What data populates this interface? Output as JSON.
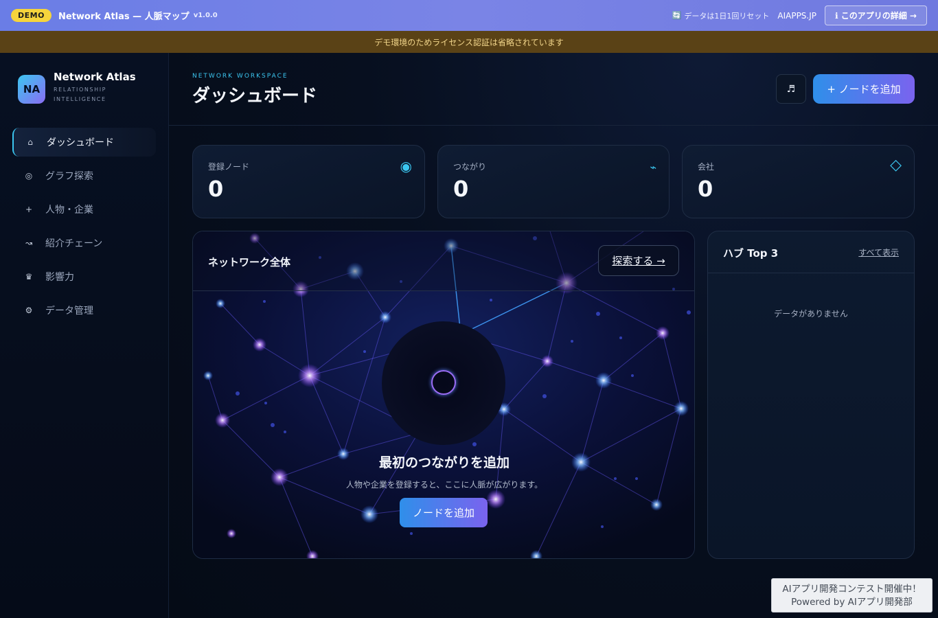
{
  "topbar": {
    "badge": "DEMO",
    "title": "Network Atlas — 人脈マップ",
    "version": "v1.0.0",
    "reset_icon": "🔄",
    "reset_note": "データは1日1回リセット",
    "site": "AIAPPS.JP",
    "detail_button": "ℹ このアプリの詳細 →"
  },
  "license_notice": "デモ環境のためライセンス認証は省略されています",
  "sidebar": {
    "logo": "NA",
    "brand_name": "Network Atlas",
    "brand_sub": "RELATIONSHIP INTELLIGENCE",
    "items": [
      {
        "icon": "⌂",
        "label": "ダッシュボード"
      },
      {
        "icon": "◎",
        "label": "グラフ探索"
      },
      {
        "icon": "+",
        "label": "人物・企業"
      },
      {
        "icon": "↝",
        "label": "紹介チェーン"
      },
      {
        "icon": "♛",
        "label": "影響力"
      },
      {
        "icon": "⚙",
        "label": "データ管理"
      }
    ]
  },
  "header": {
    "eyebrow": "NETWORK WORKSPACE",
    "title": "ダッシュボード",
    "music_icon": "♬",
    "add_button": "+ ノードを追加"
  },
  "stats": [
    {
      "label": "登録ノード",
      "value": "0",
      "icon": "◉"
    },
    {
      "label": "つながり",
      "value": "0",
      "icon": "⌁"
    },
    {
      "label": "会社",
      "value": "0",
      "icon": "◇"
    }
  ],
  "network": {
    "title": "ネットワーク全体",
    "explore_button": "探索する →",
    "empty_title": "最初のつながりを追加",
    "empty_desc": "人物や企業を登録すると、ここに人脈が広がります。",
    "empty_button": "ノードを追加"
  },
  "hub": {
    "title": "ハブ Top 3",
    "view_all": "すべて表示",
    "empty": "データがありません"
  },
  "contest_badge": {
    "line1": "AIアプリ開発コンテスト開催中！",
    "line2": "Powered by AIアプリ開発部"
  },
  "colors": {
    "accent_cyan": "#3bc6f0",
    "accent_violet": "#7a63ee",
    "demo_badge": "#f6d43c",
    "license_strip": "#5a4216"
  }
}
